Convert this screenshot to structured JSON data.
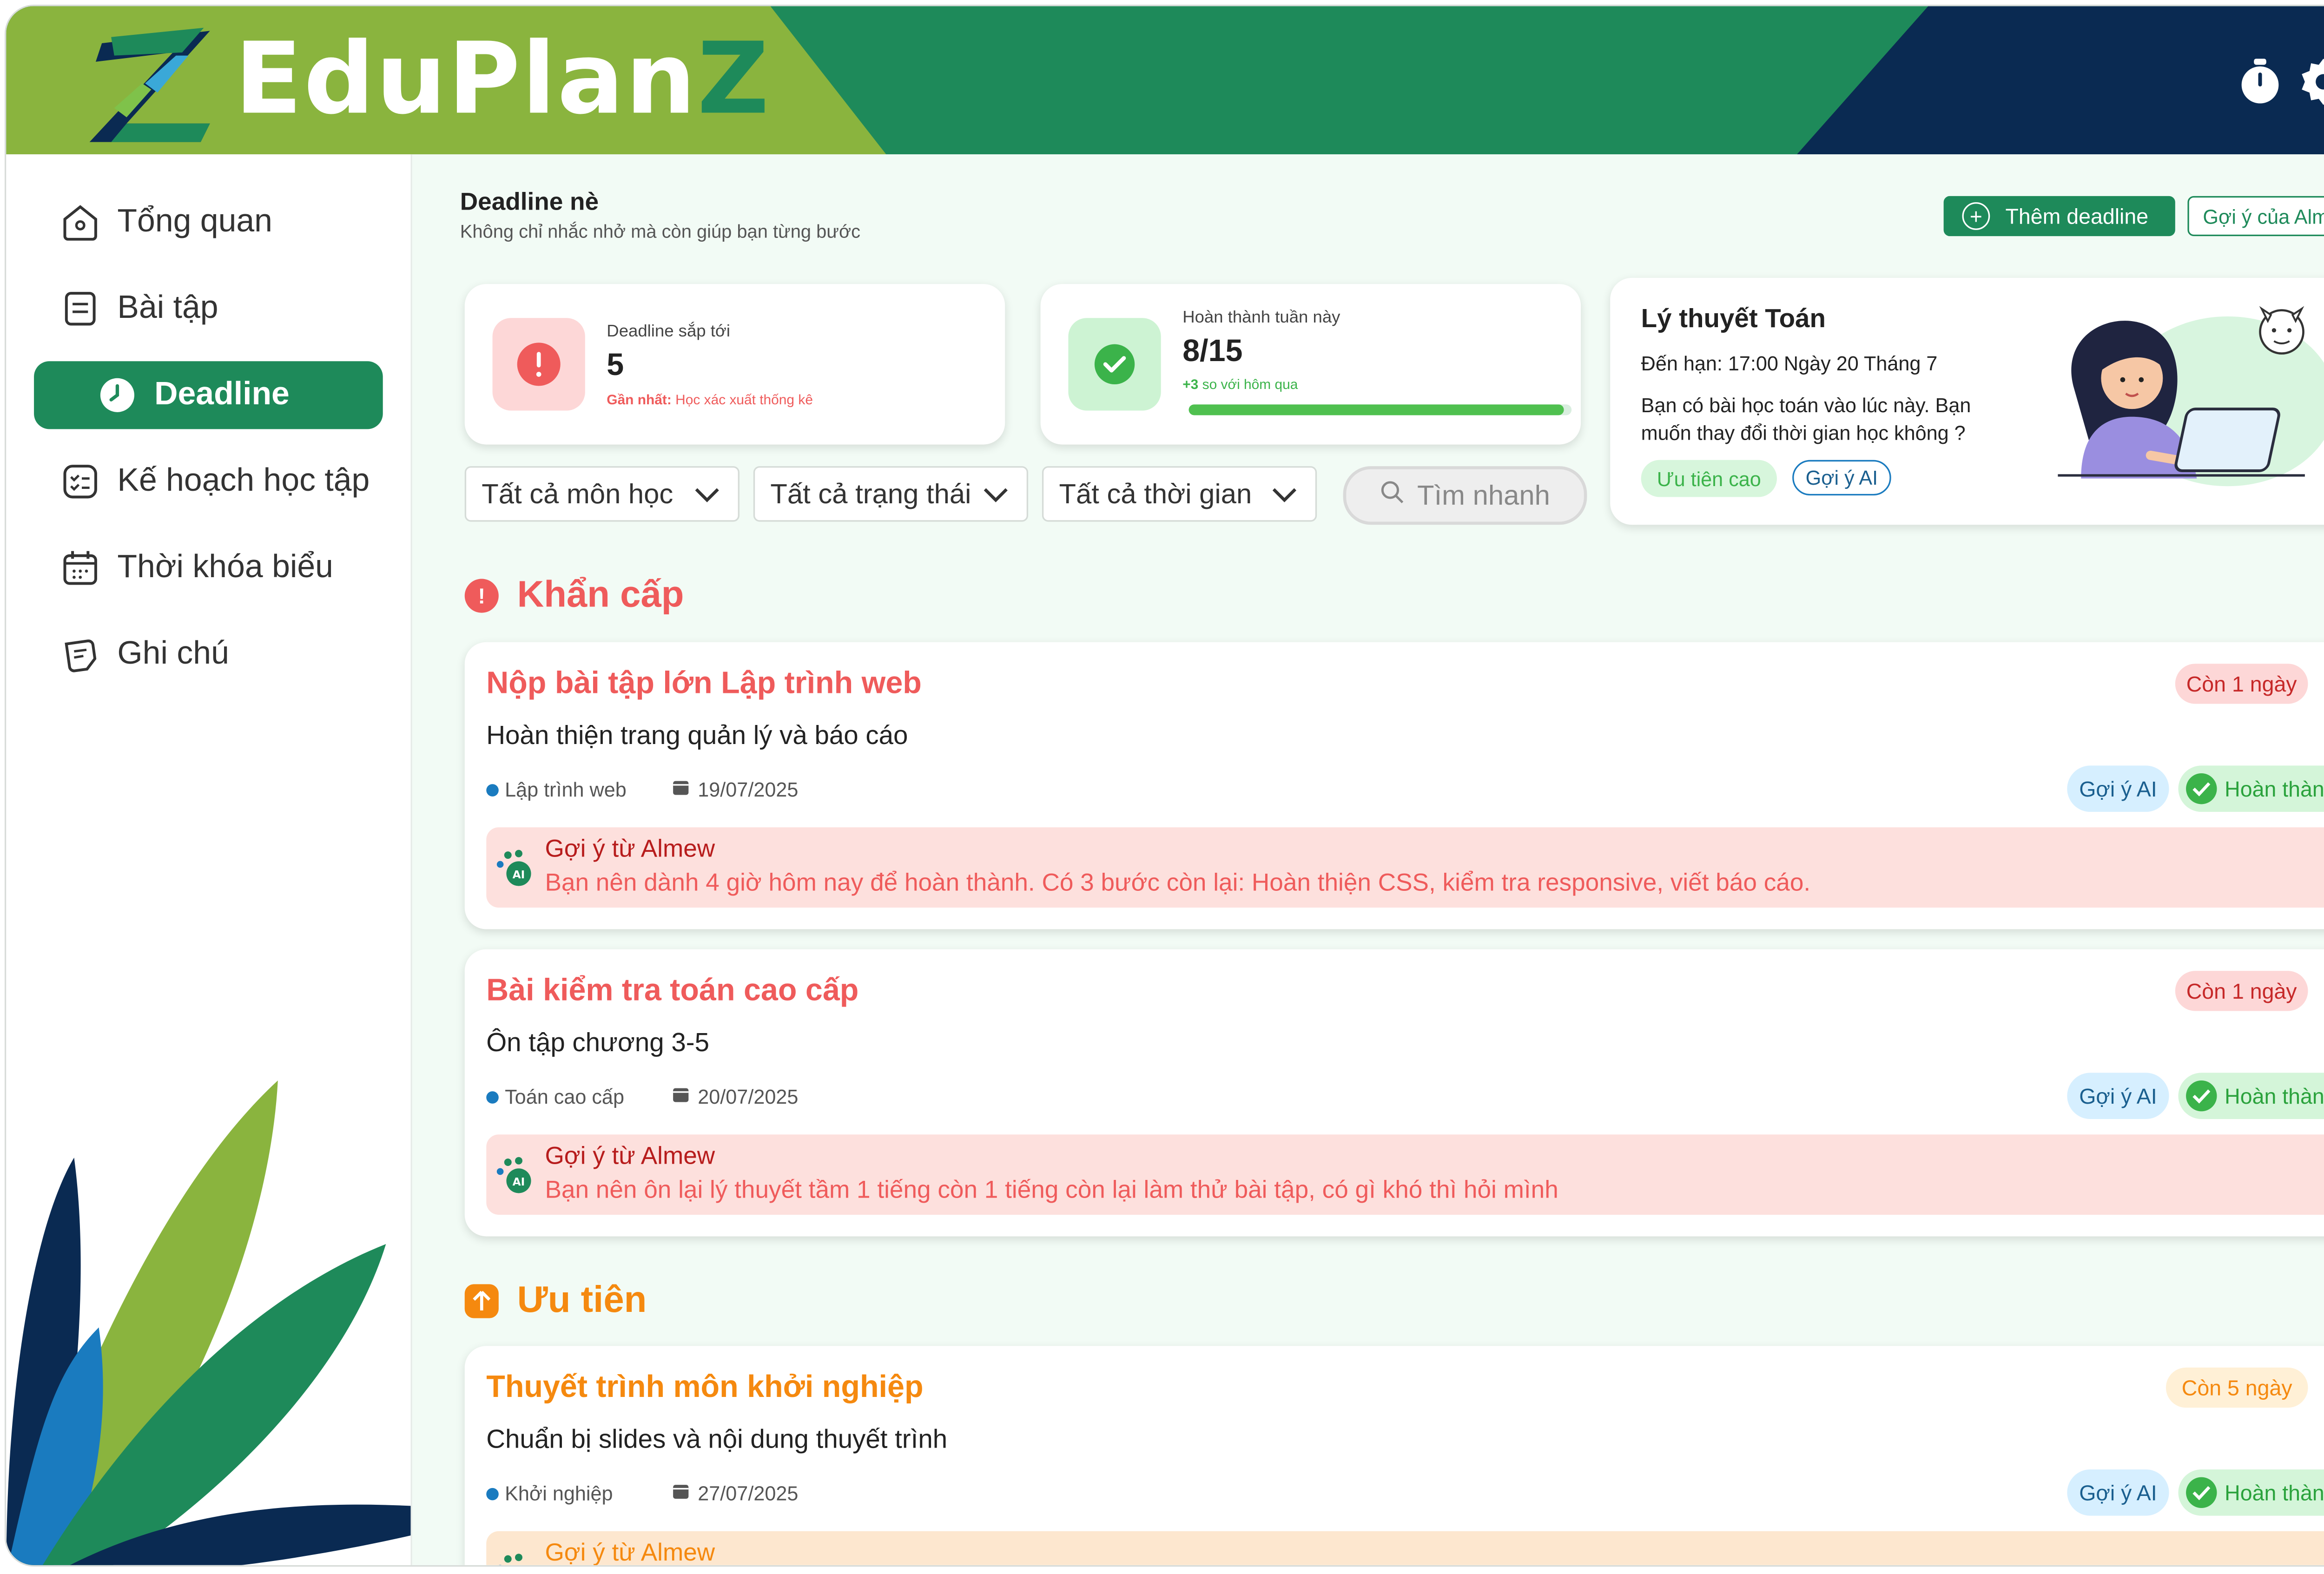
{
  "app": {
    "brand_main": "EduPlan",
    "brand_z": "Z"
  },
  "sidebar": {
    "items": [
      {
        "label": "Tổng quan",
        "icon": "home-icon"
      },
      {
        "label": "Bài tập",
        "icon": "assignment-icon"
      },
      {
        "label": "Deadline",
        "icon": "clock-icon",
        "active": true
      },
      {
        "label": "Kế hoạch học tập",
        "icon": "checklist-icon"
      },
      {
        "label": "Thời khóa biểu",
        "icon": "calendar-icon"
      },
      {
        "label": "Ghi chú",
        "icon": "note-icon"
      }
    ]
  },
  "page": {
    "title": "Deadline nè",
    "subtitle": "Không chỉ nhắc nhở mà còn giúp bạn từng bước",
    "add_button": "Thêm deadline",
    "ai_button": "Gợi ý của Almew"
  },
  "stats": {
    "upcoming": {
      "label": "Deadline sắp tới",
      "value": "5",
      "note_prefix": "Gần nhất:",
      "note_text": "Học xác xuất thống kê"
    },
    "completed": {
      "label": "Hoàn thành tuần này",
      "value": "8/15",
      "note_strong": "+3",
      "note_text": "so với hôm qua",
      "progress": 0.98
    }
  },
  "filters": {
    "subject": "Tất cả môn học",
    "status": "Tất cả trạng thái",
    "time": "Tất cả thời gian",
    "search_placeholder": "Tìm nhanh"
  },
  "tip": {
    "title": "Lý thuyết Toán",
    "due": "Đến hạn: 17:00 Ngày 20 Tháng 7",
    "text": "Bạn có bài học toán vào lúc này. Bạn muốn thay đổi thời gian học không ?",
    "chip_priority": "Ưu tiên cao",
    "chip_ai": "Gợi ý AI"
  },
  "sections": {
    "urgent": "Khẩn cấp",
    "priority": "Ưu tiên"
  },
  "tasks": [
    {
      "title": "Nộp bài tập lớn Lập trình web",
      "desc": "Hoàn thiện trang quản lý và báo cáo",
      "subject": "Lập trình web",
      "date": "19/07/2025",
      "badge": "Còn 1 ngày",
      "ai_label": "Gợi ý AI",
      "done_label": "Hoàn thành",
      "suggestion_title": "Gợi ý từ Almew",
      "suggestion": "Bạn nên dành 4 giờ hôm nay để hoàn thành. Có 3 bước còn lại: Hoàn thiện CSS, kiểm tra responsive, viết báo cáo."
    },
    {
      "title": "Bài kiểm tra toán cao cấp",
      "desc": "Ôn tập chương 3-5",
      "subject": "Toán cao cấp",
      "date": "20/07/2025",
      "badge": "Còn 1 ngày",
      "ai_label": "Gợi ý AI",
      "done_label": "Hoàn thành",
      "suggestion_title": "Gợi ý từ Almew",
      "suggestion": "Bạn nên ôn lại lý thuyết tầm 1 tiếng còn 1 tiếng còn lại làm thử bài tập, có gì khó thì hỏi mình"
    },
    {
      "title": "Thuyết trình môn khởi nghiệp",
      "desc": "Chuẩn bị slides và nội dung thuyết trình",
      "subject": "Khởi nghiệp",
      "date": "27/07/2025",
      "badge": "Còn 5 ngày",
      "ai_label": "Gợi ý AI",
      "done_label": "Hoàn thành",
      "suggestion_title": "Gợi ý từ Almew"
    }
  ],
  "colors": {
    "brand_green": "#1e8a5a",
    "lime": "#8ab43e",
    "navy": "#0a2a52",
    "urgent": "#ef5b5b",
    "priority": "#f5890f"
  }
}
